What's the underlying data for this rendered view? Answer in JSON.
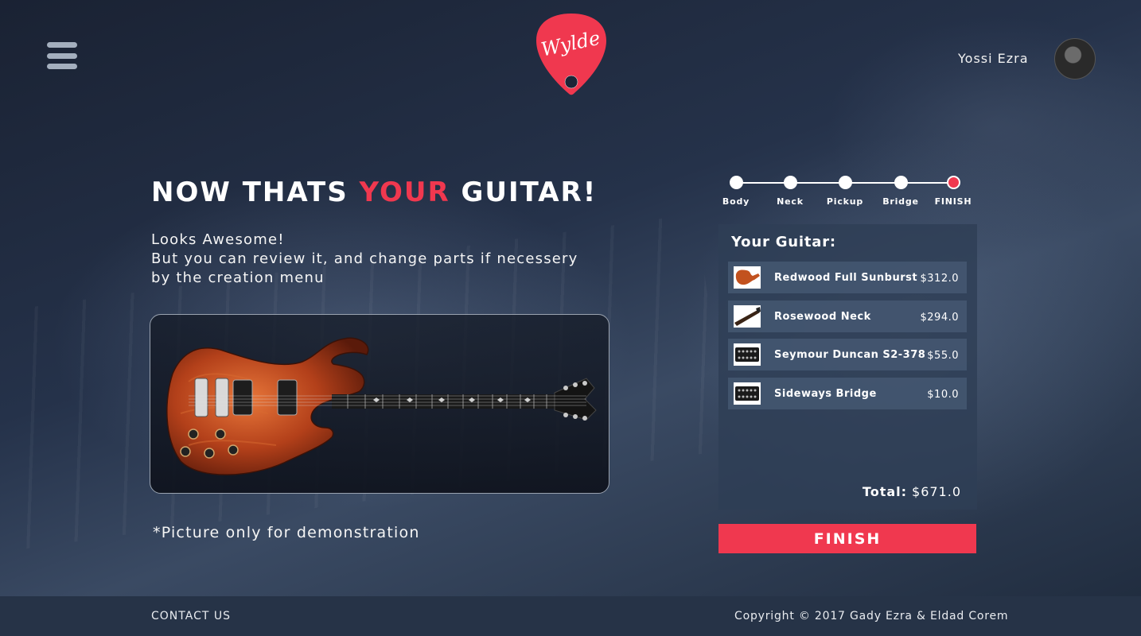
{
  "brand": {
    "logo_text": "Wylde",
    "accent_color": "#f0384f"
  },
  "header": {
    "menu_icon": "hamburger-menu-icon",
    "user_name": "Yossi Ezra",
    "avatar_icon": "user-avatar"
  },
  "hero": {
    "headline_pre": "NOW THATS ",
    "headline_accent": "YOUR",
    "headline_post": " GUITAR!",
    "sub_line1": "Looks Awesome!",
    "sub_line2": "But you can review it, and change parts if necessery",
    "sub_line3": "by the creation menu",
    "disclaimer": "*Picture only for demonstration"
  },
  "steps": [
    {
      "label": "Body",
      "active": false
    },
    {
      "label": "Neck",
      "active": false
    },
    {
      "label": "Pickup",
      "active": false
    },
    {
      "label": "Bridge",
      "active": false
    },
    {
      "label": "FINISH",
      "active": true
    }
  ],
  "summary": {
    "title": "Your Guitar:",
    "items": [
      {
        "name": "Redwood Full Sunburst",
        "price": "$312.0",
        "icon": "guitar-body-thumbnail"
      },
      {
        "name": "Rosewood Neck",
        "price": "$294.0",
        "icon": "guitar-neck-thumbnail"
      },
      {
        "name": "Seymour Duncan S2-378",
        "price": "$55.0",
        "icon": "pickup-thumbnail"
      },
      {
        "name": "Sideways Bridge",
        "price": "$10.0",
        "icon": "bridge-thumbnail"
      }
    ],
    "total_label": "Total:",
    "total_value": "$671.0"
  },
  "finish_button": "FINISH",
  "footer": {
    "contact": "CONTACT US",
    "copyright": "Copyright © 2017 Gady Ezra & Eldad Corem"
  }
}
